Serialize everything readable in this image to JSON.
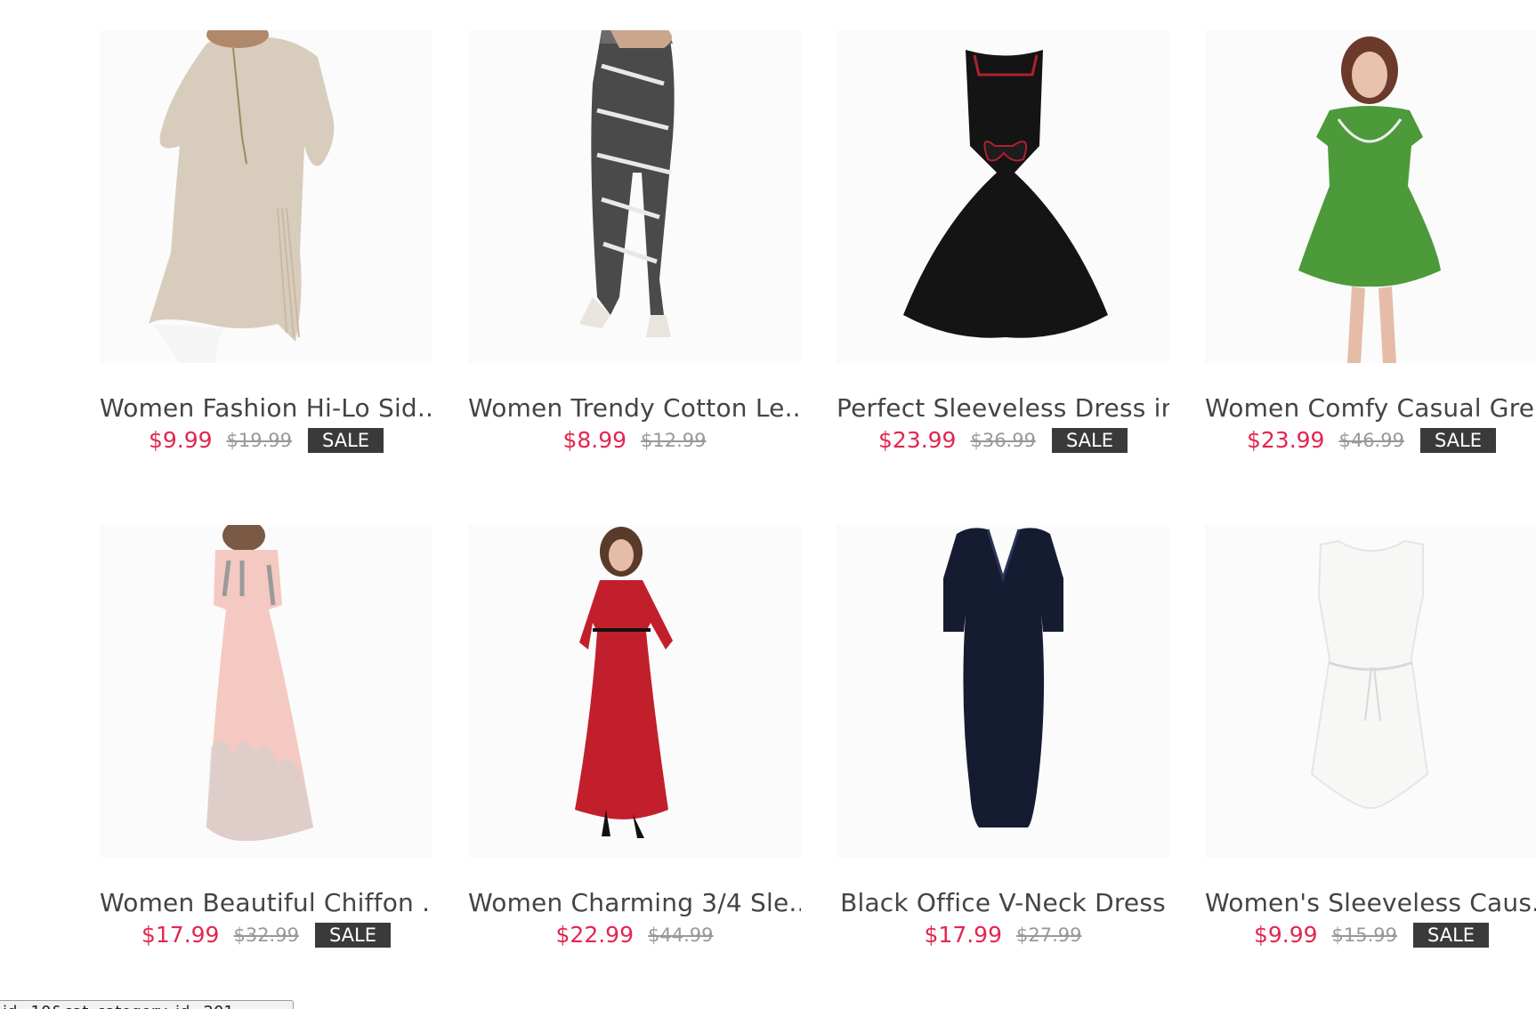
{
  "products": [
    {
      "title": "Women Fashion Hi-Lo Sid...",
      "price": "$9.99",
      "original_price": "$19.99",
      "badge": "SALE",
      "image": "beige-fringe-top"
    },
    {
      "title": "Women Trendy Cotton Le...",
      "price": "$8.99",
      "original_price": "$12.99",
      "badge": "",
      "image": "patterned-leggings"
    },
    {
      "title": "Perfect Sleeveless Dress in...",
      "price": "$23.99",
      "original_price": "$36.99",
      "badge": "SALE",
      "image": "black-bow-dress"
    },
    {
      "title": "Women Comfy Casual Gre...",
      "price": "$23.99",
      "original_price": "$46.99",
      "badge": "SALE",
      "image": "green-dress"
    },
    {
      "title": "Women Beautiful Chiffon ...",
      "price": "$17.99",
      "original_price": "$32.99",
      "badge": "SALE",
      "image": "pink-floral-maxi"
    },
    {
      "title": "Women Charming 3/4 Sle...",
      "price": "$22.99",
      "original_price": "$44.99",
      "badge": "",
      "image": "red-lace-gown"
    },
    {
      "title": "Black Office V-Neck Dress",
      "price": "$17.99",
      "original_price": "$27.99",
      "badge": "",
      "image": "navy-office-dress"
    },
    {
      "title": "Women's Sleeveless Caus...",
      "price": "$9.99",
      "original_price": "$15.99",
      "badge": "SALE",
      "image": "white-eyelet-dress"
    }
  ],
  "status_url": "id=10&cat_category_id=201",
  "colors": {
    "price": "#e3264f",
    "original_price": "#999999",
    "badge_bg": "#3a3a3a"
  }
}
